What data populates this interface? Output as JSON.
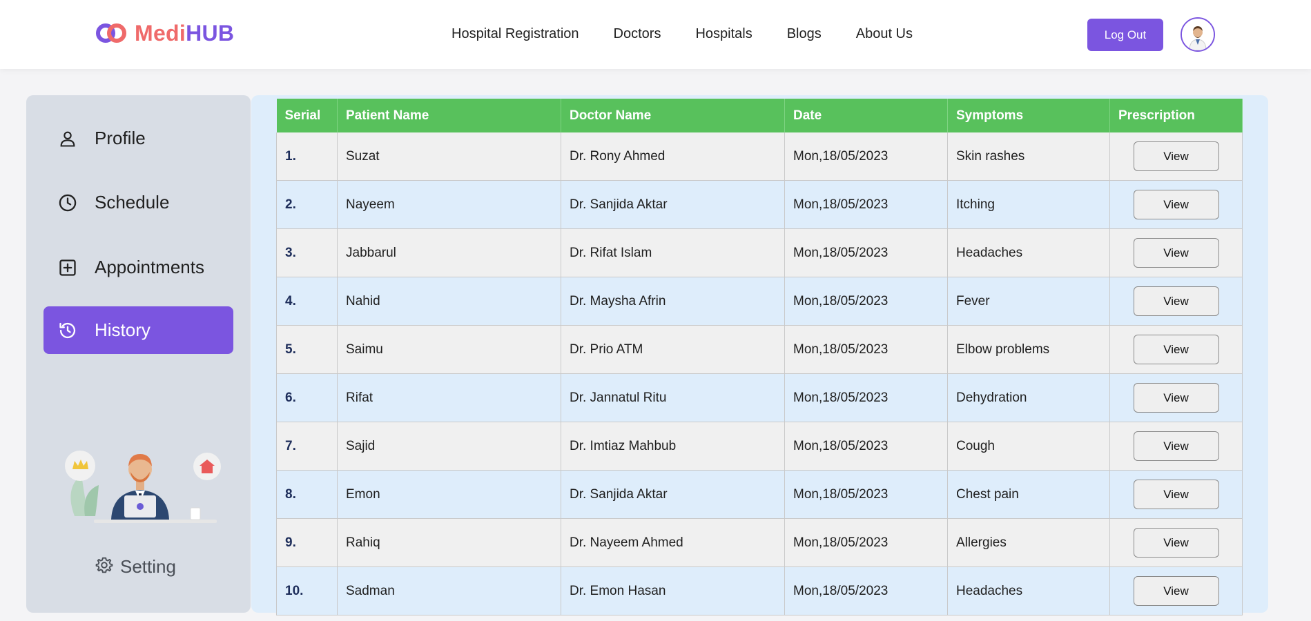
{
  "brand": {
    "part1": "Medi",
    "part2": "HUB",
    "color1": "#ef6a6a",
    "color2": "#7b55e0"
  },
  "nav": {
    "items": [
      "Hospital Registration",
      "Doctors",
      "Hospitals",
      "Blogs",
      "About Us"
    ],
    "logout_label": "Log Out",
    "avatar_icon": "doctor-avatar"
  },
  "sidebar": {
    "items": [
      {
        "label": "Profile",
        "icon": "user-icon"
      },
      {
        "label": "Schedule",
        "icon": "clock-icon"
      },
      {
        "label": "Appointments",
        "icon": "plus-square-icon"
      },
      {
        "label": "History",
        "icon": "history-icon",
        "active": true
      }
    ],
    "setting_label": "Setting",
    "accent": "#7b55e0"
  },
  "table": {
    "headers": [
      "Serial",
      "Patient Name",
      "Doctor Name",
      "Date",
      "Symptoms",
      "Prescription"
    ],
    "header_color": "#58c15c",
    "rows": [
      {
        "serial": "1.",
        "patient": "Suzat",
        "doctor": "Dr. Rony Ahmed",
        "date": "Mon,18/05/2023",
        "symptoms": "Skin rashes",
        "action": "View"
      },
      {
        "serial": "2.",
        "patient": "Nayeem",
        "doctor": "Dr. Sanjida Aktar",
        "date": "Mon,18/05/2023",
        "symptoms": "Itching",
        "action": "View"
      },
      {
        "serial": "3.",
        "patient": "Jabbarul",
        "doctor": "Dr. Rifat Islam",
        "date": "Mon,18/05/2023",
        "symptoms": "Headaches",
        "action": "View"
      },
      {
        "serial": "4.",
        "patient": "Nahid",
        "doctor": "Dr. Maysha Afrin",
        "date": "Mon,18/05/2023",
        "symptoms": "Fever",
        "action": "View"
      },
      {
        "serial": "5.",
        "patient": "Saimu",
        "doctor": "Dr. Prio ATM",
        "date": "Mon,18/05/2023",
        "symptoms": "Elbow problems",
        "action": "View"
      },
      {
        "serial": "6.",
        "patient": "Rifat",
        "doctor": "Dr. Jannatul Ritu",
        "date": "Mon,18/05/2023",
        "symptoms": "Dehydration",
        "action": "View"
      },
      {
        "serial": "7.",
        "patient": "Sajid",
        "doctor": "Dr. Imtiaz Mahbub",
        "date": "Mon,18/05/2023",
        "symptoms": "Cough",
        "action": "View"
      },
      {
        "serial": "8.",
        "patient": "Emon",
        "doctor": "Dr. Sanjida Aktar",
        "date": "Mon,18/05/2023",
        "symptoms": "Chest pain",
        "action": "View"
      },
      {
        "serial": "9.",
        "patient": "Rahiq",
        "doctor": "Dr. Nayeem Ahmed",
        "date": "Mon,18/05/2023",
        "symptoms": "Allergies",
        "action": "View"
      },
      {
        "serial": "10.",
        "patient": "Sadman",
        "doctor": "Dr. Emon Hasan",
        "date": "Mon,18/05/2023",
        "symptoms": "Headaches",
        "action": "View"
      }
    ]
  }
}
